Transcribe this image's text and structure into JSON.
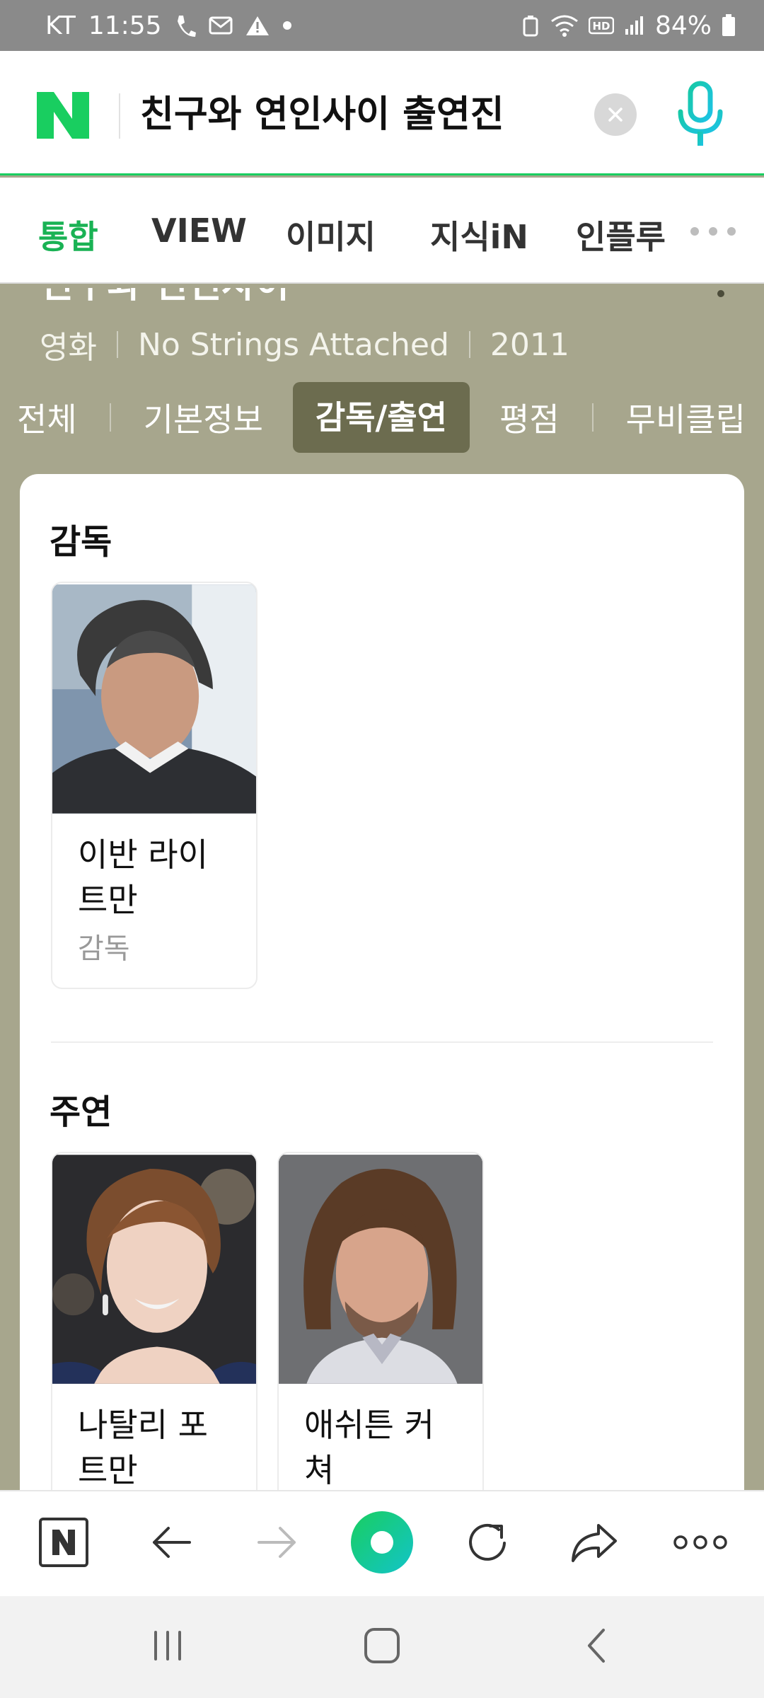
{
  "status_bar": {
    "carrier": "KT",
    "time": "11:55",
    "battery": "84%"
  },
  "search": {
    "query": "친구와 연인사이 출연진"
  },
  "tabs": [
    {
      "label": "통합",
      "active": true
    },
    {
      "label": "VIEW"
    },
    {
      "label": "이미지"
    },
    {
      "label": "지식iN"
    },
    {
      "label": "인플루"
    }
  ],
  "movie": {
    "title": "친구와 연인사이",
    "category": "영화",
    "original_title": "No Strings Attached",
    "year": "2011"
  },
  "sub_tabs": [
    {
      "label": "전체"
    },
    {
      "label": "기본정보"
    },
    {
      "label": "감독/출연",
      "active": true
    },
    {
      "label": "평점"
    },
    {
      "label": "무비클립"
    }
  ],
  "director_section": {
    "title": "감독",
    "people": [
      {
        "name_line1": "이반 라이",
        "name_line2": "트만",
        "role": "감독"
      }
    ]
  },
  "cast_section": {
    "title": "주연",
    "people": [
      {
        "name_line1": "나탈리 포",
        "name_line2": "트만"
      },
      {
        "name_line1": "애쉬튼 커",
        "name_line2": "쳐"
      }
    ]
  },
  "colors": {
    "naver_green": "#19ce60",
    "olive_background": "#a7a68d",
    "active_subtab": "#6c6c4f"
  }
}
